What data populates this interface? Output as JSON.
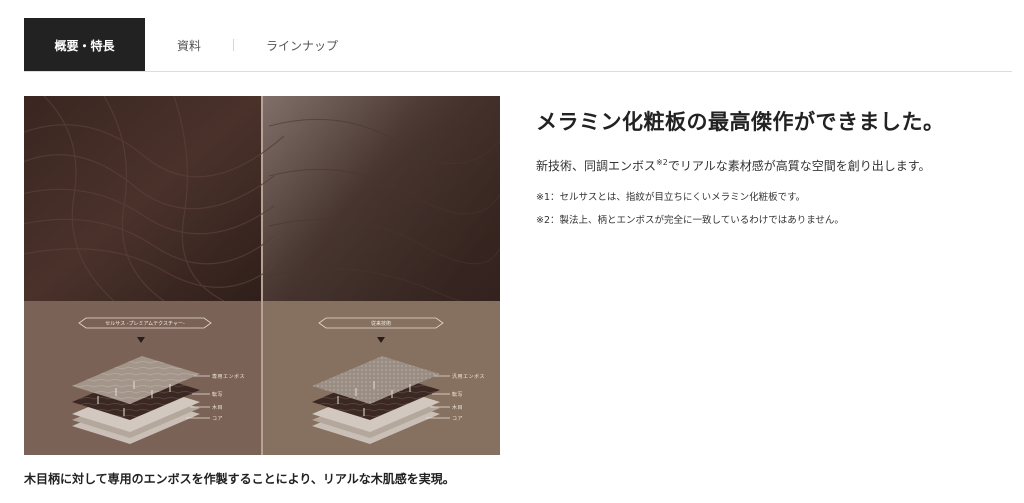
{
  "tabs": [
    {
      "label": "概要・特長",
      "active": true
    },
    {
      "label": "資料",
      "active": false
    },
    {
      "label": "ラインナップ",
      "active": false
    }
  ],
  "figure": {
    "left_title": "セルサス -プレミアムテクスチャー-",
    "right_title": "従来技術",
    "left_layers": [
      "専用エンボス",
      "転写",
      "木目",
      "コア"
    ],
    "right_layers": [
      "汎用エンボス",
      "転写",
      "木目",
      "コア"
    ],
    "colors": {
      "wood_dark": "#3b2621",
      "lower_panel": "#7d6458",
      "lower_panel_right": "#8a7266"
    }
  },
  "caption": "木目柄に対して専用のエンボスを作製することにより、リアルな木肌感を実現。",
  "headline": "メラミン化粧板の最高傑作ができました。",
  "description": {
    "before": "新技術、同調エンボス",
    "sup": "※2",
    "after": "でリアルな素材感が高質な空間を創り出します。"
  },
  "notes": [
    "※1：セルサスとは、指紋が目立ちにくいメラミン化粧板です。",
    "※2：製法上、柄とエンボスが完全に一致しているわけではありません。"
  ]
}
